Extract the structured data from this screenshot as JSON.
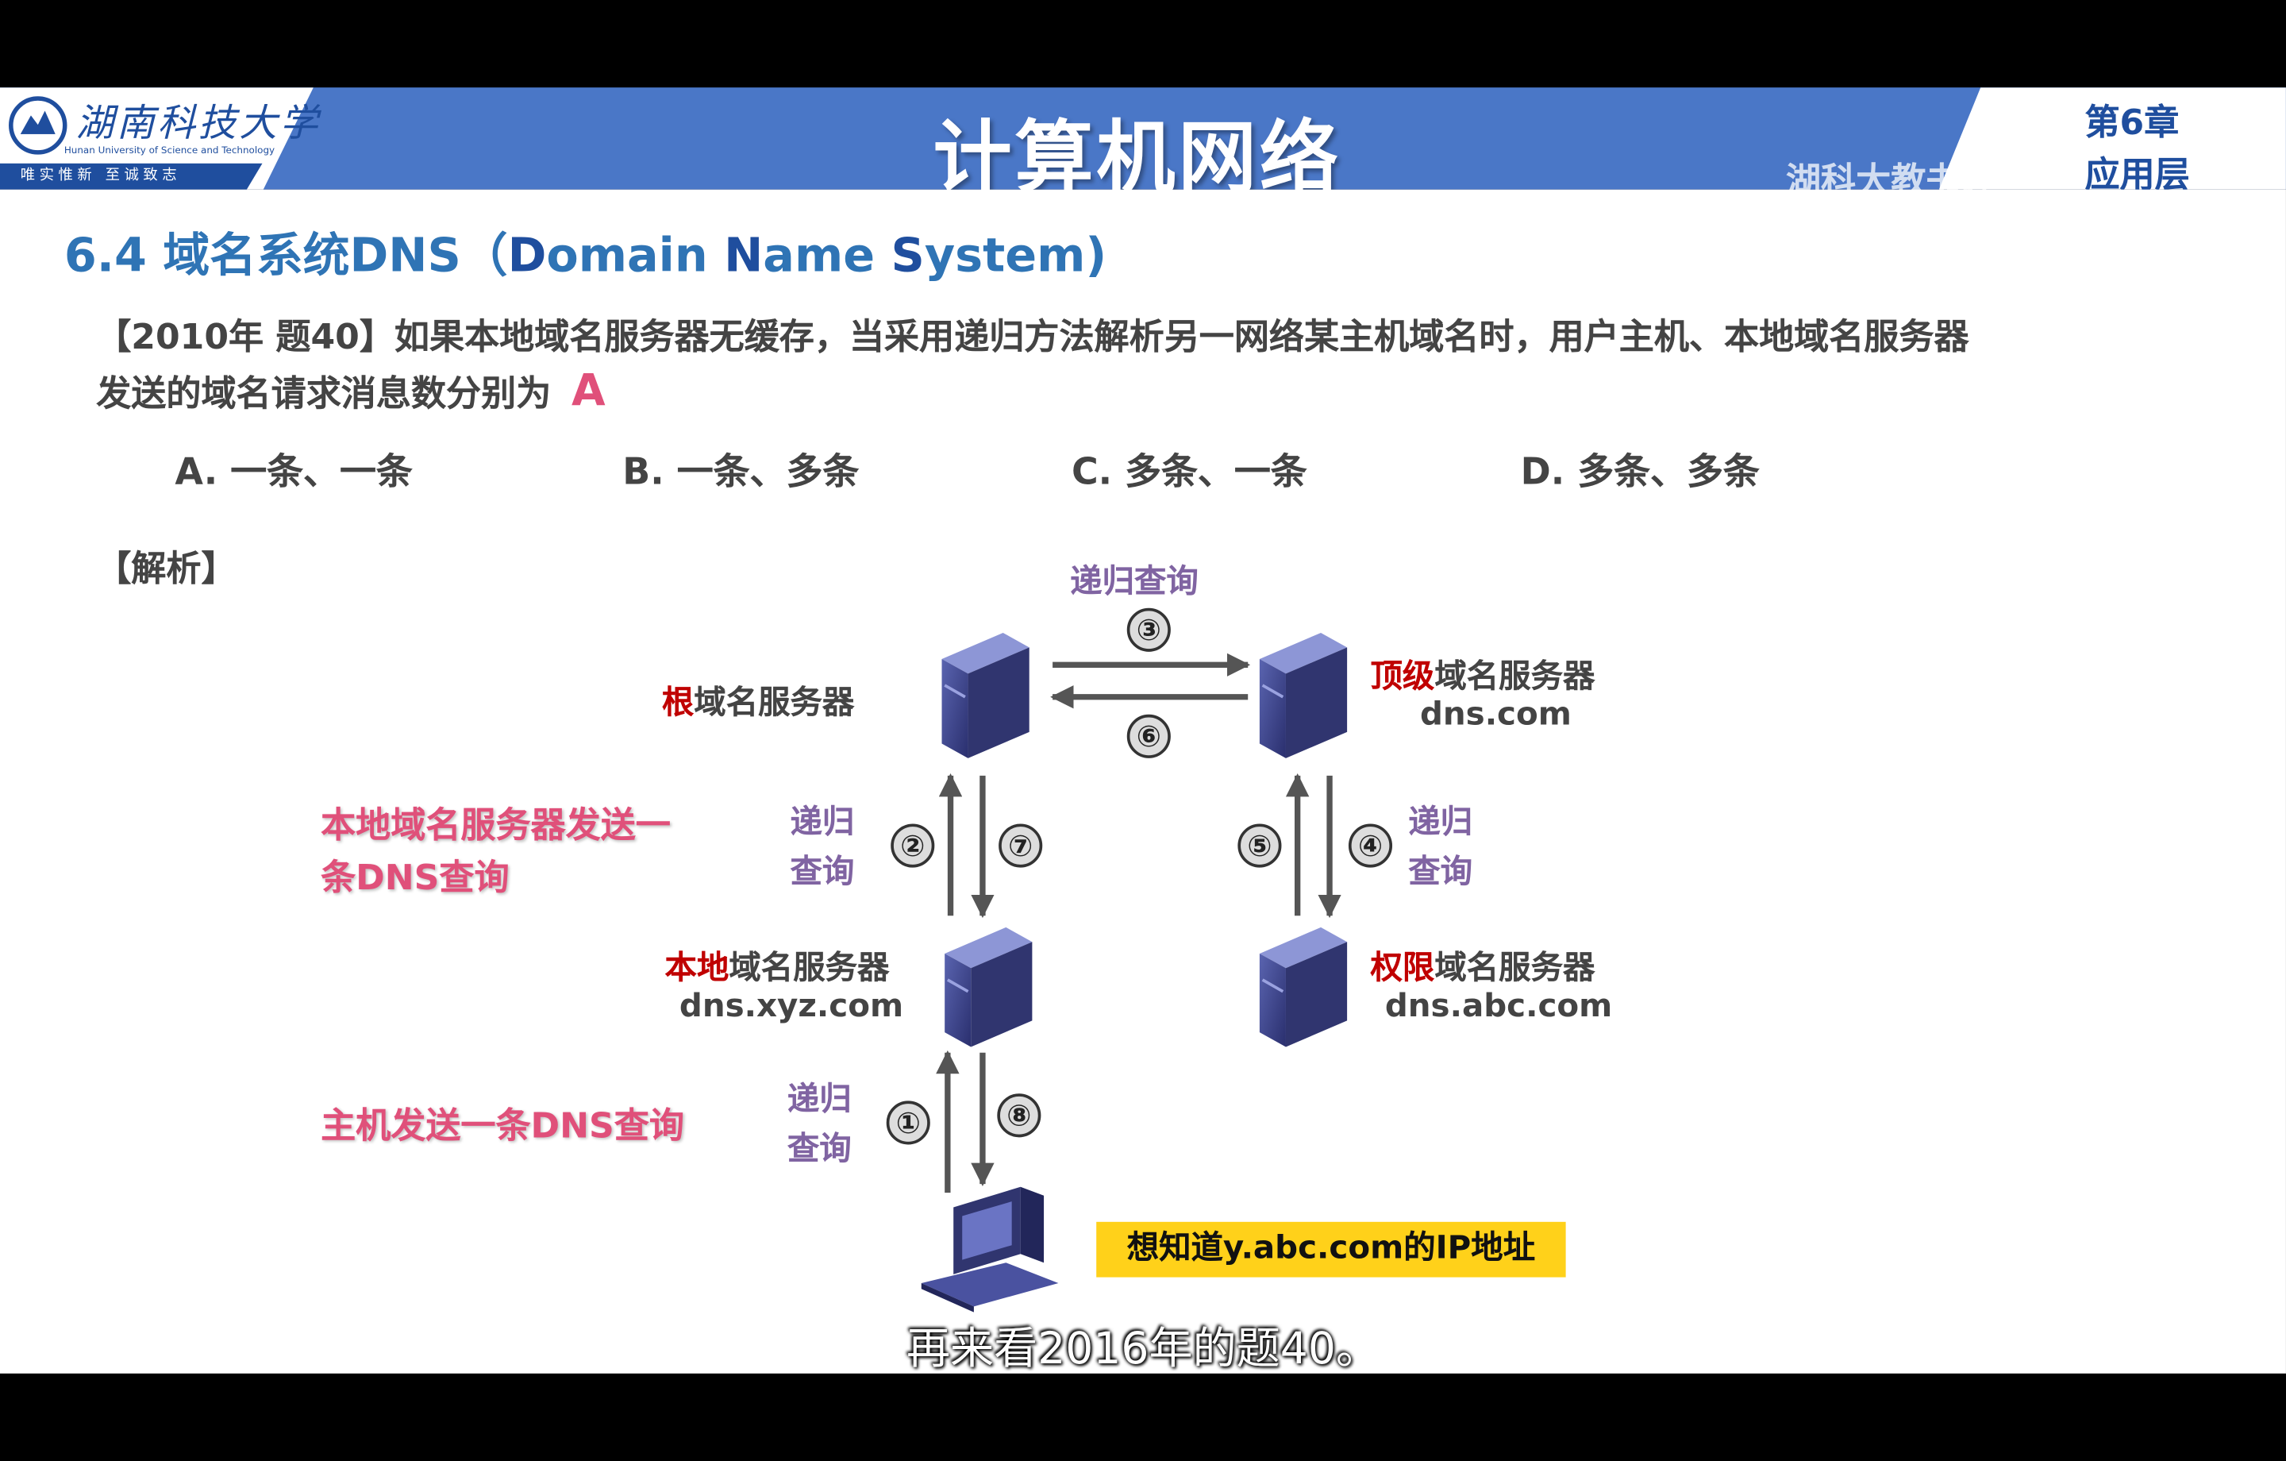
{
  "header": {
    "school_name": "湖南科技大学",
    "school_name_en": "Hunan University of Science and Technology",
    "motto": "唯实惟新 至诚致志",
    "title": "计算机网络",
    "chapter_number": "第6章",
    "chapter_name": "应用层",
    "watermark": "湖科大教书匠"
  },
  "section_title_prefix": "6.4 域名系统DNS（",
  "section_title_parts": [
    "D",
    "omain ",
    "N",
    "ame ",
    "S",
    "ystem)"
  ],
  "question": {
    "text": "【2010年 题40】如果本地域名服务器无缓存，当采用递归方法解析另一网络某主机域名时，用户主机、本地域名服务器发送的域名请求消息数分别为",
    "answer": "A",
    "options": [
      "A. 一条、一条",
      "B. 一条、多条",
      "C. 多条、一条",
      "D. 多条、多条"
    ]
  },
  "analysis_label": "【解析】",
  "diagram": {
    "root_server": {
      "highlight": "根",
      "rest": "域名服务器"
    },
    "tld_server": {
      "highlight": "顶级",
      "rest": "域名服务器",
      "domain": "dns.com"
    },
    "local_server": {
      "highlight": "本地",
      "rest": "域名服务器",
      "domain": "dns.xyz.com"
    },
    "auth_server": {
      "highlight": "权限",
      "rest": "域名服务器",
      "domain": "dns.abc.com"
    },
    "recursive_query": "递归查询",
    "recursive_line1": "递归",
    "recursive_line2": "查询",
    "steps": [
      "①",
      "②",
      "③",
      "④",
      "⑤",
      "⑥",
      "⑦",
      "⑧"
    ],
    "note_local_line1": "本地域名服务器发送一",
    "note_local_line2": "条DNS查询",
    "note_host": "主机发送一条DNS查询",
    "goal": "想知道y.abc.com的IP地址"
  },
  "subtitle": "再来看2016年的题40。",
  "colors": {
    "header_blue": "#4a77c7",
    "title_blue": "#2f74b5",
    "answer_pink": "#e0507a",
    "query_purple": "#8064a2",
    "highlight_red": "#c00000",
    "goal_yellow": "#ffd11a"
  }
}
